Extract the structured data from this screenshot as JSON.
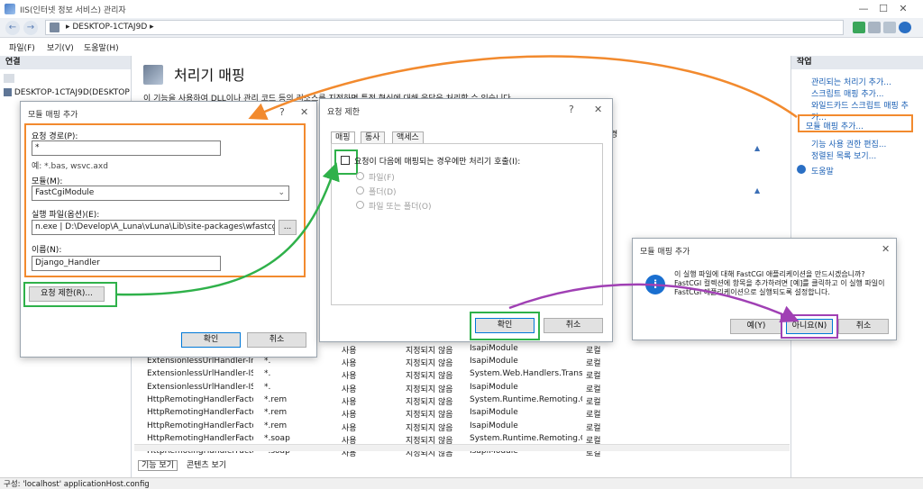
{
  "window": {
    "title": "IIS(인터넷 정보 서비스) 관리자",
    "minimize": "—",
    "maximize": "☐",
    "close": "✕"
  },
  "address": {
    "crumb": "▸  DESKTOP-1CTAJ9D  ▸",
    "back": "←",
    "forward": "→"
  },
  "menubar": [
    "파일(F)",
    "보기(V)",
    "도움말(H)"
  ],
  "connections": {
    "title": "연결",
    "tree_item": "DESKTOP-1CTAJ9D(DESKTOP"
  },
  "main": {
    "title": "처리기 매핑",
    "description": "이 기능을 사용하여 DLL이나 관리 코드 등의 리소스를 지정하면 특정 형식에 대해 응답을 처리할 수 있습니다.",
    "rows": [
      {
        "name": "ExtensionlessUrlHandler-Integ...",
        "path": "*.",
        "state": "사용",
        "type": "지정되지 않음",
        "handler": "IsapiModule",
        "entry": "로컬"
      },
      {
        "name": "ExtensionlessUrlHandler-ISAPI...",
        "path": "*.",
        "state": "사용",
        "type": "지정되지 않음",
        "handler": "System.Web.Handlers.Transfe...",
        "entry": "로컬"
      },
      {
        "name": "ExtensionlessUrlHandler-ISAPI...",
        "path": "*.",
        "state": "사용",
        "type": "지정되지 않음",
        "handler": "IsapiModule",
        "entry": "로컬"
      },
      {
        "name": "HttpRemotingHandlerFactory...",
        "path": "*.rem",
        "state": "사용",
        "type": "지정되지 않음",
        "handler": "System.Runtime.Remoting.C...",
        "entry": "로컬"
      },
      {
        "name": "HttpRemotingHandlerFactory...",
        "path": "*.rem",
        "state": "사용",
        "type": "지정되지 않음",
        "handler": "IsapiModule",
        "entry": "로컬"
      },
      {
        "name": "HttpRemotingHandlerFactory...",
        "path": "*.rem",
        "state": "사용",
        "type": "지정되지 않음",
        "handler": "IsapiModule",
        "entry": "로컬"
      },
      {
        "name": "HttpRemotingHandlerFactory...",
        "path": "*.soap",
        "state": "사용",
        "type": "지정되지 않음",
        "handler": "System.Runtime.Remoting.C...",
        "entry": "로컬"
      },
      {
        "name": "HttpRemotingHandlerFactory...",
        "path": "*.soap",
        "state": "사용",
        "type": "지정되지 않음",
        "handler": "IsapiModule",
        "entry": "로컬"
      }
    ],
    "partial_row": {
      "state": "사용",
      "type": "지정되지 않음",
      "handler": "IsapiModule",
      "entry": "로컬"
    },
    "header_fragment": "경"
  },
  "bottom_tabs": {
    "features": "기능 보기",
    "content": "콘텐츠 보기"
  },
  "status": "구성: 'localhost' applicationHost.config",
  "actions": {
    "title": "작업",
    "links": [
      "관리되는 처리기 추가...",
      "스크립트 매핑 추가...",
      "와일드카드 스크립트 매핑 추가...",
      "모듈 매핑 추가...",
      "기능 사용 권한 편집...",
      "정렬된 목록 보기..."
    ],
    "help": "도움말"
  },
  "module_dialog": {
    "title": "모듈 매핑 추가",
    "request_path_label": "요청 경로(P):",
    "request_path_value": "*",
    "example": "예: *.bas, wsvc.axd",
    "module_label": "모듈(M):",
    "module_value": "FastCgiModule",
    "exe_label": "실행 파일(옵션)(E):",
    "exe_value": "n.exe | D:\\Develop\\A_Luna\\vLuna\\Lib\\site-packages\\wfastcgi.py",
    "browse": "...",
    "name_label": "이름(N):",
    "name_value": "Django_Handler",
    "restrict_button": "요청 제한(R)...",
    "ok": "확인",
    "cancel": "취소",
    "help": "?",
    "close": "✕"
  },
  "restrict_dialog": {
    "title": "요청 제한",
    "tabs": [
      "매핑",
      "동사",
      "액세스"
    ],
    "checkbox_label": "요청이 다음에 매핑되는 경우에만 처리기 호출(I):",
    "radios": [
      "파일(F)",
      "폴더(D)",
      "파일 또는 폴더(O)"
    ],
    "ok": "확인",
    "cancel": "취소",
    "help": "?",
    "close": "✕"
  },
  "confirm_dialog": {
    "title": "모듈 매핑 추가",
    "message": "이 실행 파일에 대해 FastCGI 애플리케이션을 만드시겠습니까? FastCGI 컬렉션에 항목을 추가하려면 [예]를 클릭하고 이 실행 파일이 FastCGI 애플리케이션으로 실행되도록 설정합니다.",
    "yes": "예(Y)",
    "no": "아니요(N)",
    "cancel": "취소",
    "close": "✕"
  },
  "colors": {
    "highlight_orange": "#f28a2e",
    "highlight_green": "#2fb14a",
    "highlight_purple": "#a040b4",
    "link_blue": "#1a5fb4"
  }
}
